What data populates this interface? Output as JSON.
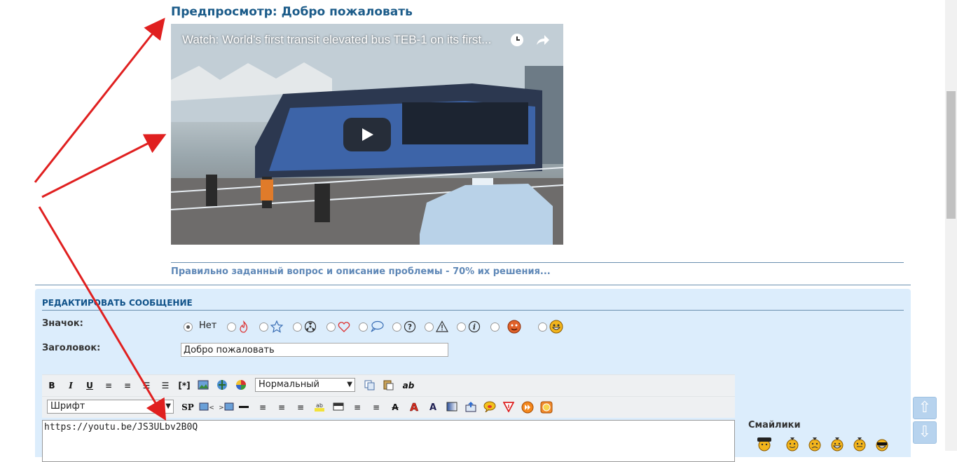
{
  "preview": {
    "title": "Предпросмотр: Добро пожаловать",
    "video_title": "Watch: World's first transit elevated bus TEB-1 on its first...",
    "signature": "Правильно заданный вопрос и описание проблемы - 70% их решения..."
  },
  "editor": {
    "heading": "РЕДАКТИРОВАТЬ СООБЩЕНИЕ",
    "icon_label": "Значок:",
    "icon_none": "Нет",
    "subject_label": "Заголовок:",
    "subject_value": "Добро пожаловать",
    "size_select": "Нормальный",
    "font_select": "Шрифт",
    "message": "https://youtu.be/JS3ULbv2B0Q",
    "smileys_label": "Смайлики",
    "sp_label": "SP",
    "ab_label": "ab"
  },
  "colors": {
    "accent": "#1b5b89",
    "panel": "#dcedfc",
    "arrow": "#e02020"
  },
  "icons": [
    "fire-icon",
    "star-icon",
    "radiation-icon",
    "heart-icon",
    "speech-icon",
    "question-icon",
    "warning-icon",
    "info-icon",
    "face-icon",
    "smile-icon"
  ]
}
